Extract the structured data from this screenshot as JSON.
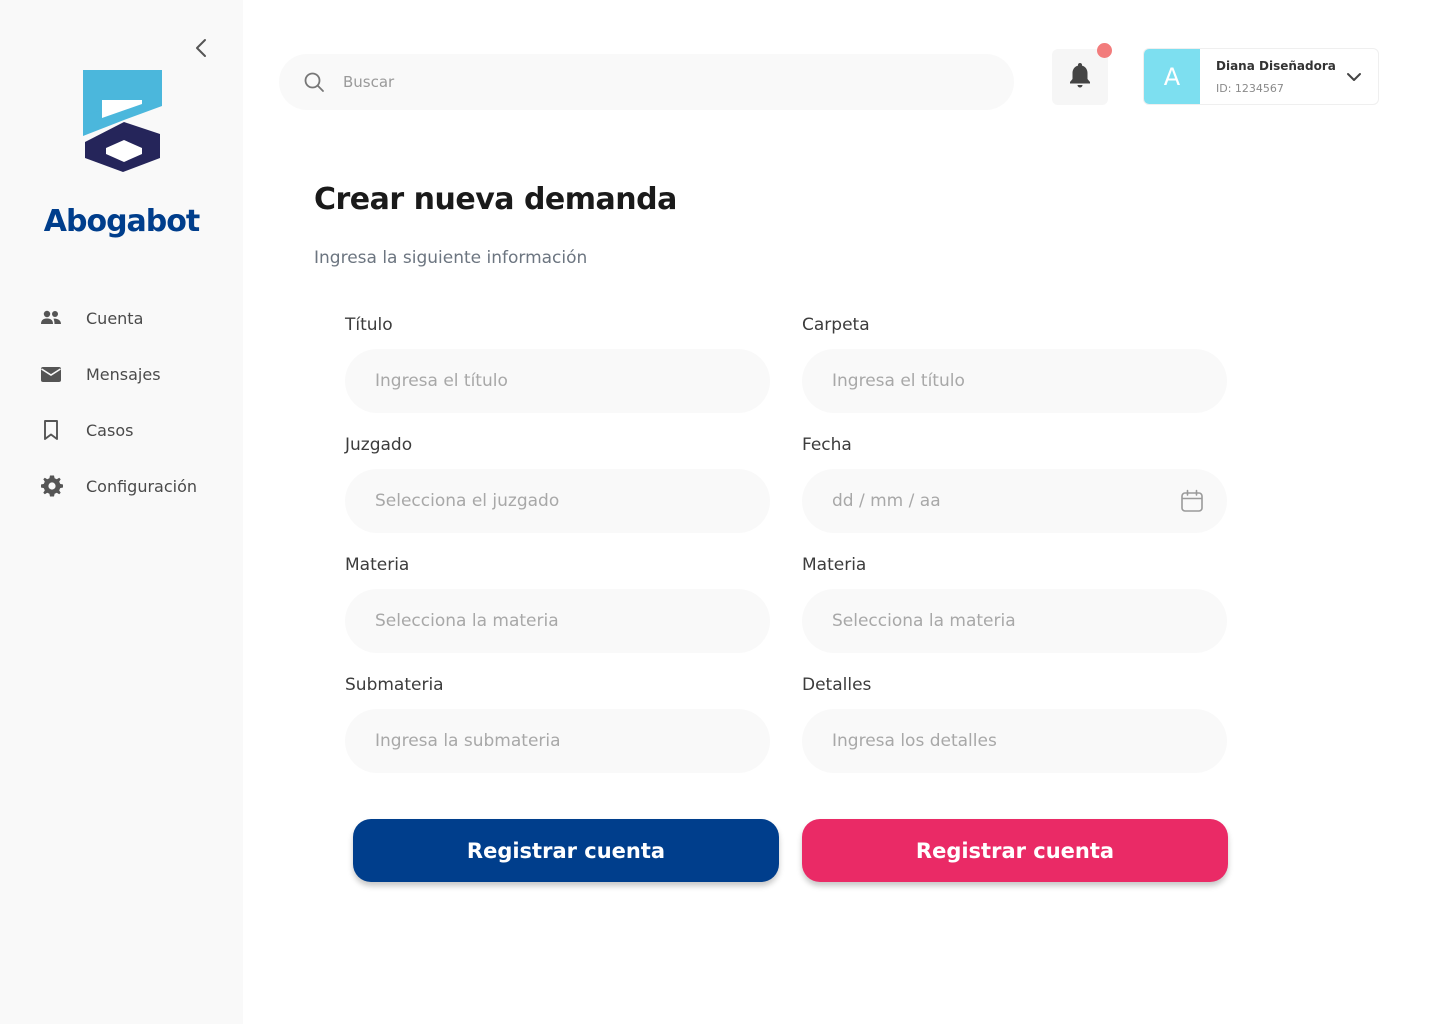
{
  "colors": {
    "brand_dark": "#003e8c",
    "brand_light": "#4bb7dc",
    "logo_dark": "#25255a",
    "primary_button": "#003e8c",
    "secondary_button": "#ea2a66",
    "avatar_bg": "#7ddff0",
    "notification_dot": "#f27c7c"
  },
  "sidebar": {
    "brand": "Abogabot",
    "items": [
      {
        "label": "Cuenta",
        "icon": "people-icon"
      },
      {
        "label": "Mensajes",
        "icon": "envelope-icon"
      },
      {
        "label": "Casos",
        "icon": "bookmark-icon"
      },
      {
        "label": "Configuración",
        "icon": "gear-icon"
      }
    ]
  },
  "header": {
    "search_placeholder": "Buscar",
    "user": {
      "initial": "A",
      "name": "Diana Diseñadora",
      "id": "ID: 1234567"
    }
  },
  "main": {
    "title": "Crear nueva demanda",
    "subtitle": "Ingresa la siguiente información",
    "fields": {
      "titulo": {
        "label": "Título",
        "placeholder": "Ingresa el título"
      },
      "carpeta": {
        "label": "Carpeta",
        "placeholder": "Ingresa el título"
      },
      "juzgado": {
        "label": "Juzgado",
        "placeholder": "Selecciona el juzgado"
      },
      "fecha": {
        "label": "Fecha",
        "placeholder": "dd / mm / aa"
      },
      "materia_1": {
        "label": "Materia",
        "placeholder": "Selecciona la materia"
      },
      "materia_2": {
        "label": "Materia",
        "placeholder": "Selecciona la materia"
      },
      "submateria": {
        "label": "Submateria",
        "placeholder": "Ingresa la submateria"
      },
      "detalles": {
        "label": "Detalles",
        "placeholder": "Ingresa los detalles"
      }
    },
    "buttons": {
      "primary": "Registrar cuenta",
      "secondary": "Registrar cuenta"
    }
  }
}
